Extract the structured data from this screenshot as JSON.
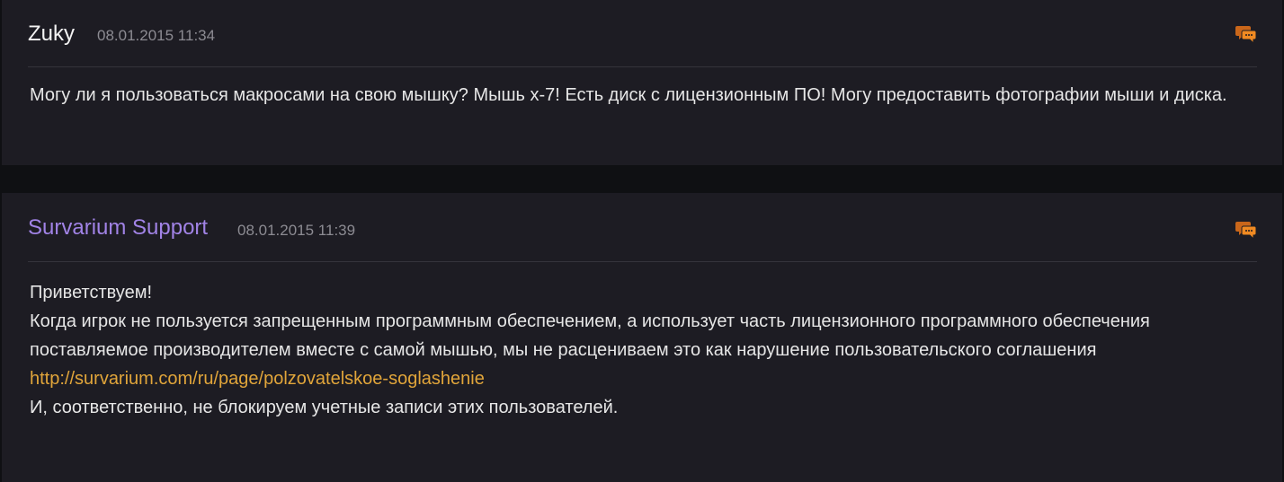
{
  "posts": [
    {
      "author": "Zuky",
      "timestamp": "08.01.2015 11:34",
      "body": "Могу ли я пользоваться макросами на свою мышку? Мышь х-7! Есть диск с лицензионным ПО! Могу предоставить фотографии мыши и диска.",
      "reply_icon": "reply-bubbles-icon"
    },
    {
      "author": "Survarium Support",
      "timestamp": "08.01.2015 11:39",
      "greeting": "Приветствуем!",
      "body_before_link": "Когда игрок не пользуется запрещенным программным обеспечением, а использует часть лицензионного программного обеспечения поставляемое производителем вместе с самой мышью, мы не расцениваем это как нарушение пользовательского соглашения ",
      "link": "http://survarium.com/ru/page/polzovatelskoe-soglashenie",
      "closing": "И, соответственно, не блокируем учетные записи этих пользователей.",
      "reply_icon": "reply-bubbles-icon"
    }
  ],
  "colors": {
    "page_background": "#0f1013",
    "post_background": "#1d1c23",
    "support_author": "#a183e6",
    "link": "#e1a53a",
    "icon": "#e07b1f"
  }
}
